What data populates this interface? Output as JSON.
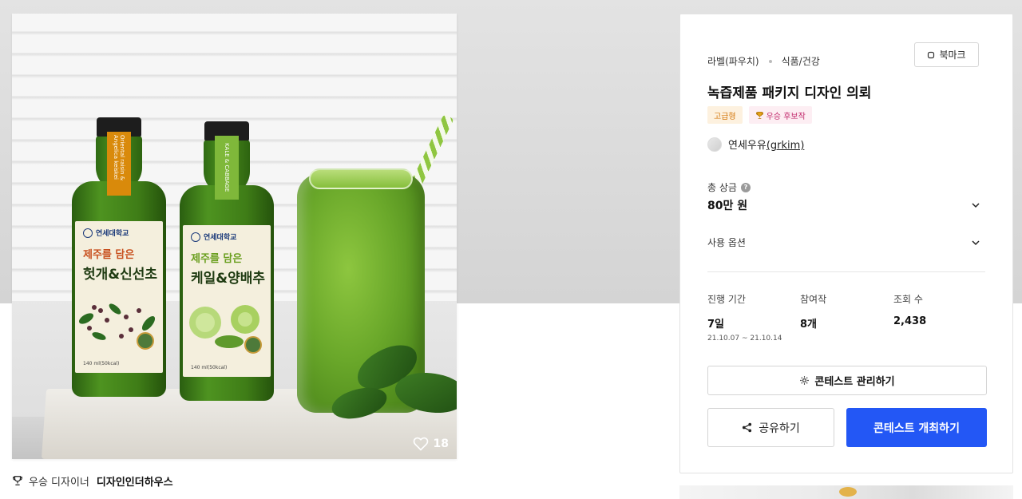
{
  "image": {
    "likes": "18",
    "bottles": [
      {
        "tab_text": "Oriental raisin & Angelica keiskei",
        "university": "연세대학교",
        "line1": "제주를 담은",
        "line2": "헛개&신선초",
        "nutrition": "140 ml(50kcal)",
        "accent_color": "#d98a0b",
        "line1_color": "#c8501e"
      },
      {
        "tab_text": "KALE & CABBAGE",
        "university": "연세대학교",
        "line1": "제주를 담은",
        "line2": "케일&양배추",
        "nutrition": "140 ml(50kcal)",
        "accent_color": "#7fb83a",
        "line1_color": "#6a9f1f"
      }
    ]
  },
  "winner": {
    "prefix": "우승 디자이너",
    "name": "디자인인더하우스"
  },
  "panel": {
    "category": "라벨(파우치)",
    "subcategory": "식품/건강",
    "bookmark_label": "북마크",
    "title": "녹즙제품 패키지 디자인 의뢰",
    "badges": {
      "grade": "고급형",
      "candidate": "우승 후보작"
    },
    "host": {
      "name": "연세우유",
      "handle": "(grkim)"
    },
    "prize": {
      "label": "총 상금",
      "value": "80만 원"
    },
    "options_label": "사용 옵션",
    "stats": {
      "period": {
        "label": "진행 기간",
        "value": "7일",
        "range_start": "21.10.07",
        "range_sep": "~",
        "range_end": "21.10.14"
      },
      "entries": {
        "label": "참여작",
        "value": "8개"
      },
      "views": {
        "label": "조회 수",
        "value": "2,438"
      }
    },
    "manage_label": "콘테스트 관리하기",
    "share_label": "공유하기",
    "host_contest_label": "콘테스트 개최하기"
  },
  "colors": {
    "primary": "#2357f5",
    "grade_badge_bg": "#fdf1df",
    "grade_badge_text": "#d4780d",
    "candidate_badge_bg": "#fdeef3",
    "candidate_badge_text": "#c1286b"
  },
  "icons": [
    "heart-icon",
    "trophy-icon",
    "bookmark-icon",
    "help-icon",
    "chevron-down-icon",
    "gear-icon",
    "share-icon"
  ]
}
